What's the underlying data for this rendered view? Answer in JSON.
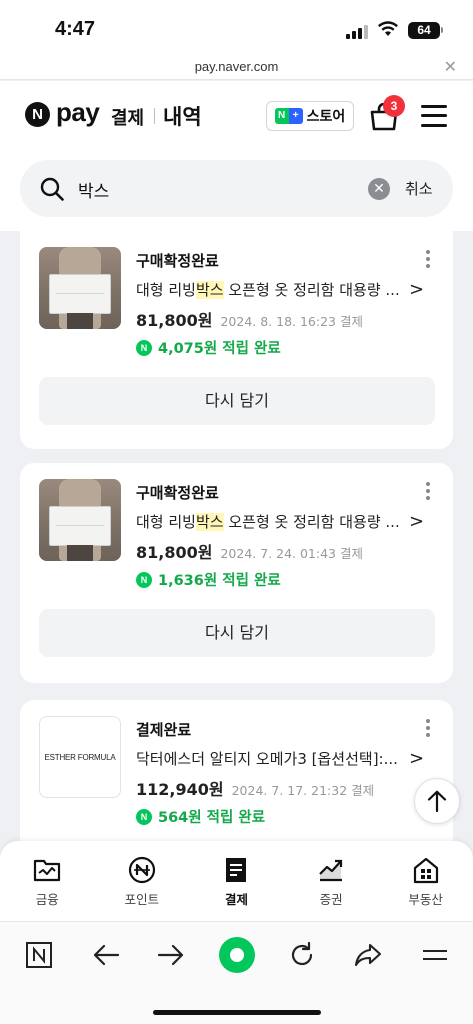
{
  "status_bar": {
    "time": "4:47",
    "battery": "64"
  },
  "browser_top": {
    "url": "pay.naver.com",
    "close_icon": "close-icon"
  },
  "header": {
    "logo_n": "N",
    "logo_pay": "pay",
    "tab_payment": "결제",
    "tab_history": "내역",
    "store_button": {
      "n": "N",
      "plus": "+",
      "label": "스토어"
    },
    "cart_badge": "3"
  },
  "search": {
    "query": "박스",
    "cancel_label": "취소"
  },
  "orders": [
    {
      "status": "구매확정완료",
      "title_before": "대형 리빙",
      "title_highlight": "박스",
      "title_after": " 오픈형 옷 정리함 대용량 ...",
      "price": "81,800원",
      "date": "2024. 8. 18. 16:23 결제",
      "point": "4,075원 적립 완료",
      "readd_label": "다시 담기"
    },
    {
      "status": "구매확정완료",
      "title_before": "대형 리빙",
      "title_highlight": "박스",
      "title_after": " 오픈형 옷 정리함 대용량 ...",
      "price": "81,800원",
      "date": "2024. 7. 24. 01:43 결제",
      "point": "1,636원 적립 완료",
      "readd_label": "다시 담기"
    },
    {
      "status": "결제완료",
      "brand_logo": "ESTHER FORMULA",
      "title_before": "닥터에스더 알티지 오메가3 [옵션선택]:...",
      "title_highlight": "",
      "title_after": "",
      "price": "112,940원",
      "date": "2024. 7. 17. 21:32 결제",
      "point": "564원 적립 완료"
    }
  ],
  "tabbar": [
    {
      "label": "금융",
      "icon": "finance-folder-icon"
    },
    {
      "label": "포인트",
      "icon": "point-coin-icon"
    },
    {
      "label": "결제",
      "icon": "payment-receipt-icon",
      "active": true
    },
    {
      "label": "증권",
      "icon": "stock-chart-icon"
    },
    {
      "label": "부동산",
      "icon": "real-estate-building-icon"
    }
  ],
  "colors": {
    "naver_green": "#03c75a",
    "badge_red": "#f2313b",
    "highlight": "#fff6b8",
    "point_green": "#13a84a"
  }
}
